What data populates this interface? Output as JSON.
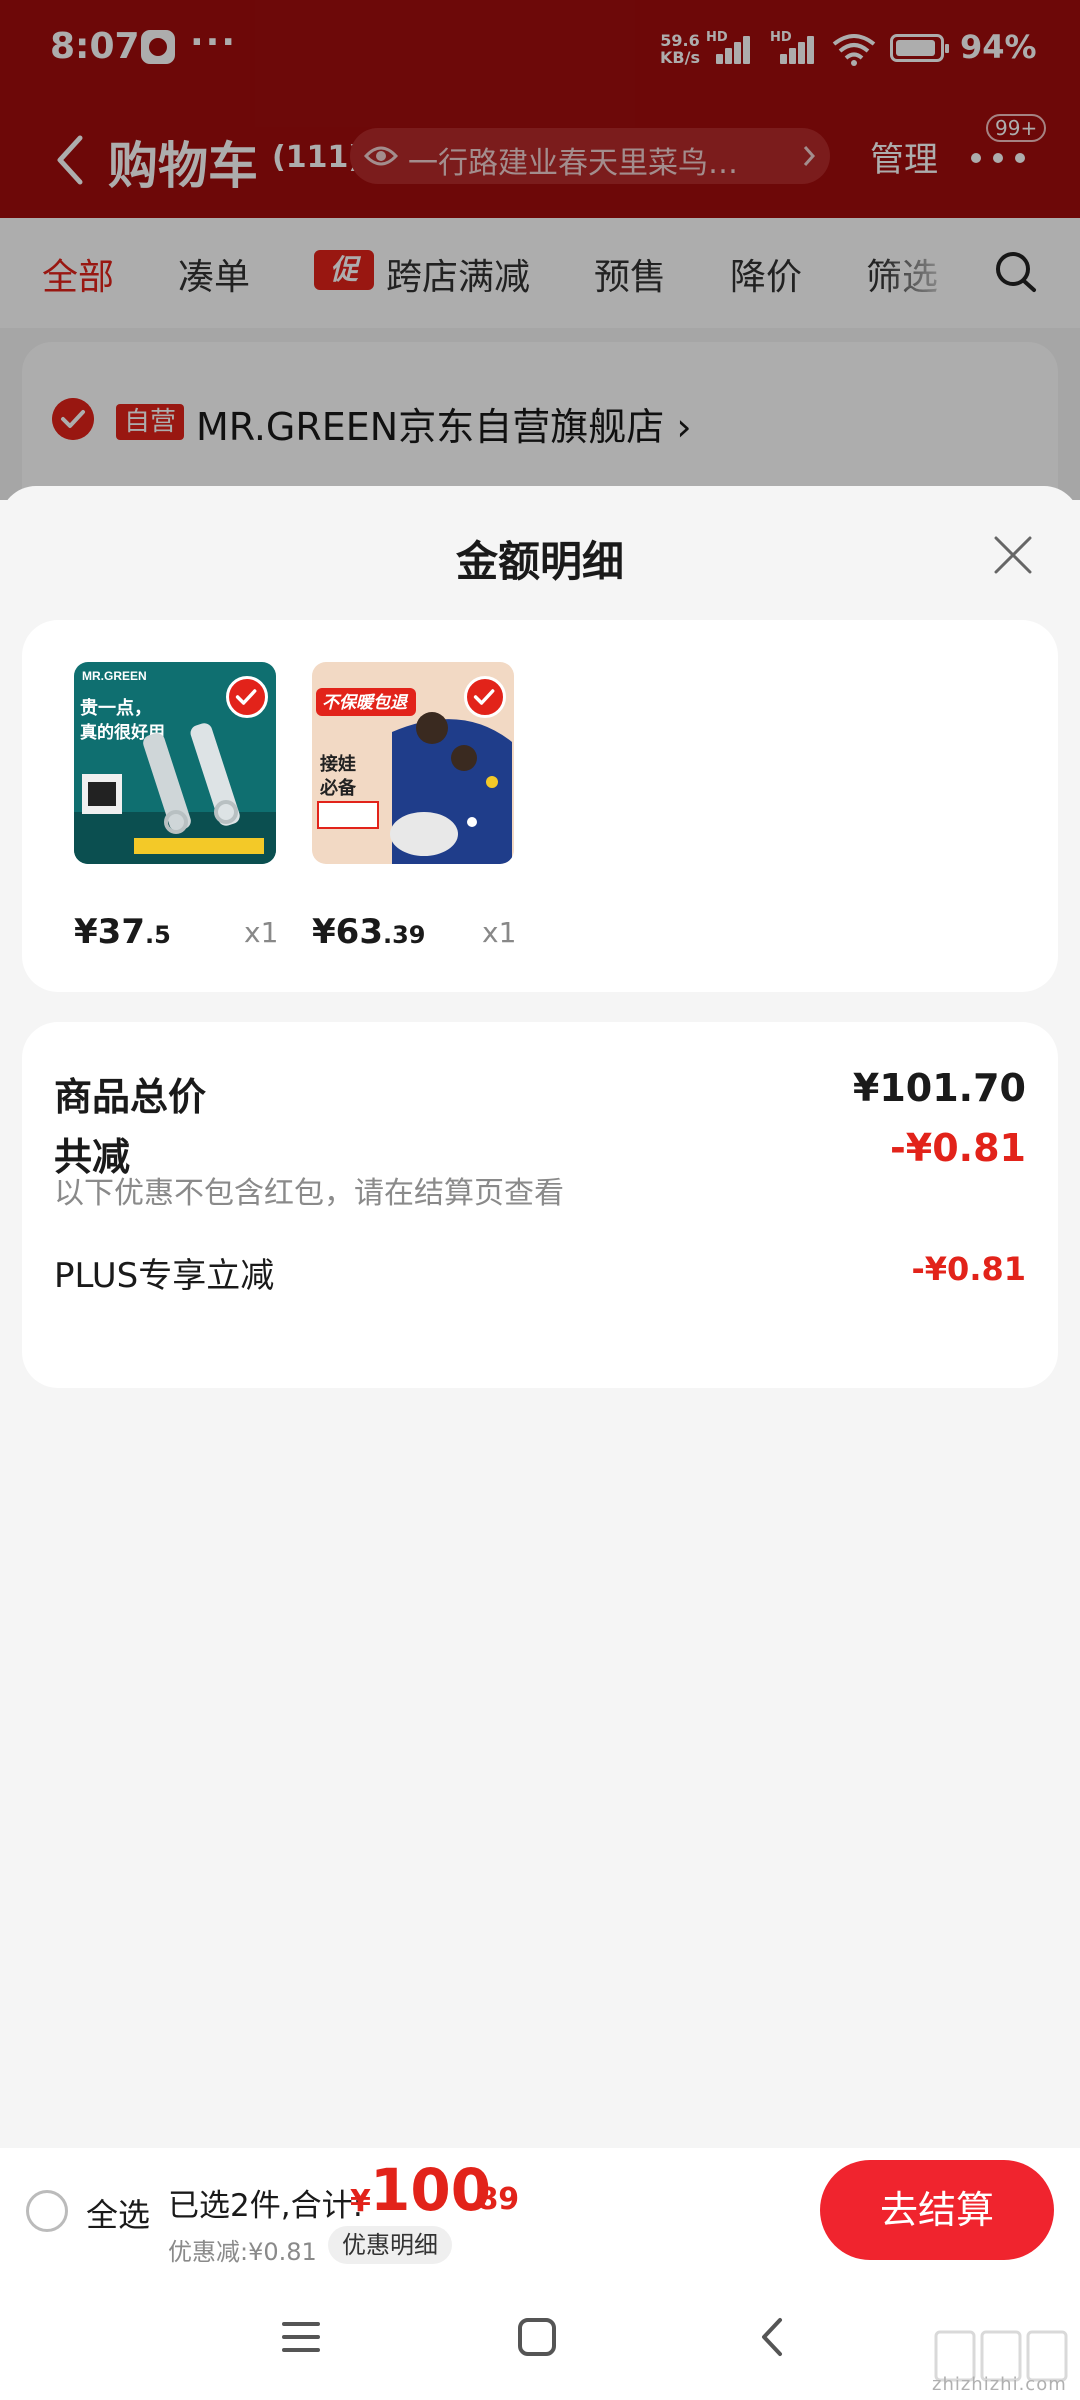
{
  "status_bar": {
    "time": "8:07",
    "dots": "···",
    "speed_top": "59.6",
    "speed_bottom": "KB/s",
    "hd": "HD",
    "battery": "94%",
    "battery_level": 0.94
  },
  "header": {
    "title": "购物车",
    "count": "(111)",
    "address": "一行路建业春天里菜鸟…",
    "manage": "管理",
    "badge": "99+"
  },
  "tabs": [
    {
      "label": "全部",
      "active": true
    },
    {
      "label": "凑单"
    },
    {
      "label": "跨店满减",
      "tag": "促"
    },
    {
      "label": "预售"
    },
    {
      "label": "降价"
    },
    {
      "label": "筛选"
    }
  ],
  "store": {
    "tag": "自营",
    "name": "MR.GREEN京东自营旗舰店",
    "chevron": "›"
  },
  "sheet": {
    "title": "金额明细",
    "products": [
      {
        "price_int": "¥37",
        "price_dec": ".5",
        "qty": "x1",
        "image": "nail-clipper-set",
        "img_texts": [
          "MR.GREEN",
          "贵一点，",
          "真的很好用"
        ]
      },
      {
        "price_int": "¥63",
        "price_dec": ".39",
        "qty": "x1",
        "image": "scooter-windshield",
        "img_texts": [
          "不保暖包退",
          "接娃",
          "必备"
        ]
      }
    ],
    "summary": {
      "total_label": "商品总价",
      "total_value": "¥101.70",
      "discount_label": "共减",
      "discount_value": "-¥0.81",
      "note": "以下优惠不包含红包，请在结算页查看",
      "plus_label": "PLUS专享立减",
      "plus_value": "-¥0.81"
    }
  },
  "checkout": {
    "select_all": "全选",
    "selected_text": "已选2件,合计:",
    "total_currency": "¥",
    "total_int": "100",
    "total_dec": ".89",
    "discount_text": "优惠减:¥0.81",
    "detail_button": "优惠明细",
    "checkout_button": "去结算"
  },
  "watermark": {
    "text": "zhizhizhi.com",
    "glyph": "值值值"
  },
  "colors": {
    "header_red": "#a10d0d",
    "accent_red": "#e2231a",
    "checkout_red": "#f0242e"
  }
}
